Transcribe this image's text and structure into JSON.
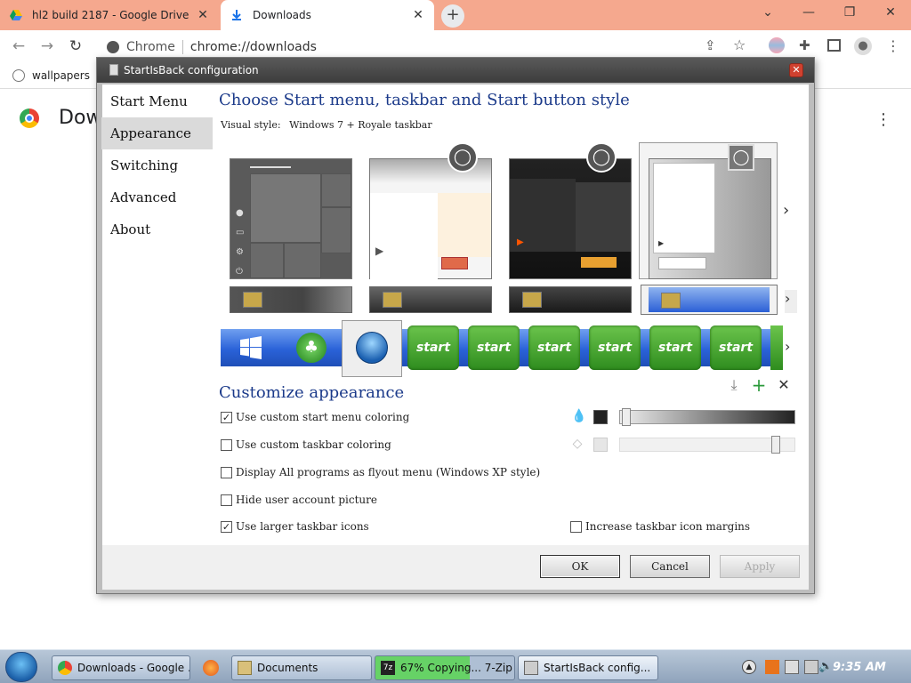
{
  "browser": {
    "tabs": [
      {
        "title": "hl2 build 2187 - Google Drive"
      },
      {
        "title": "Downloads",
        "active": true
      }
    ],
    "omnibox": {
      "site": "Chrome",
      "url": "chrome://downloads"
    },
    "bookmarks": [
      {
        "label": "wallpapers"
      }
    ],
    "page_title": "Dow",
    "accent_color": "#f5a88e"
  },
  "dialog": {
    "title": "StartIsBack configuration",
    "nav": [
      {
        "label": "Start Menu"
      },
      {
        "label": "Appearance",
        "selected": true
      },
      {
        "label": "Switching"
      },
      {
        "label": "Advanced"
      },
      {
        "label": "About"
      }
    ],
    "heading": "Choose Start menu, taskbar and Start button style",
    "visual_style_label": "Visual style:",
    "visual_style_value": "Windows 7 + Royale taskbar",
    "start_button_label": "start",
    "customize_heading": "Customize appearance",
    "options": [
      {
        "label": "Use custom start menu coloring",
        "checked": true
      },
      {
        "label": "Use custom taskbar coloring",
        "checked": false
      },
      {
        "label": "Display All programs as flyout menu (Windows XP style)",
        "checked": false
      },
      {
        "label": "Hide user account picture",
        "checked": false
      },
      {
        "label": "Use larger taskbar icons",
        "checked": true
      },
      {
        "label": "Increase taskbar icon margins",
        "checked": false
      }
    ],
    "buttons": {
      "ok": "OK",
      "cancel": "Cancel",
      "apply": "Apply"
    },
    "menu_color": "#222222",
    "taskbar_color": "#e6e6e6"
  },
  "taskbar": {
    "items": [
      {
        "label": "Downloads - Google ..."
      },
      {
        "label": "Documents"
      },
      {
        "label": "67% Copying... 7-Zip"
      },
      {
        "label": "StartIsBack config..."
      }
    ],
    "clock": "9:35 AM"
  }
}
